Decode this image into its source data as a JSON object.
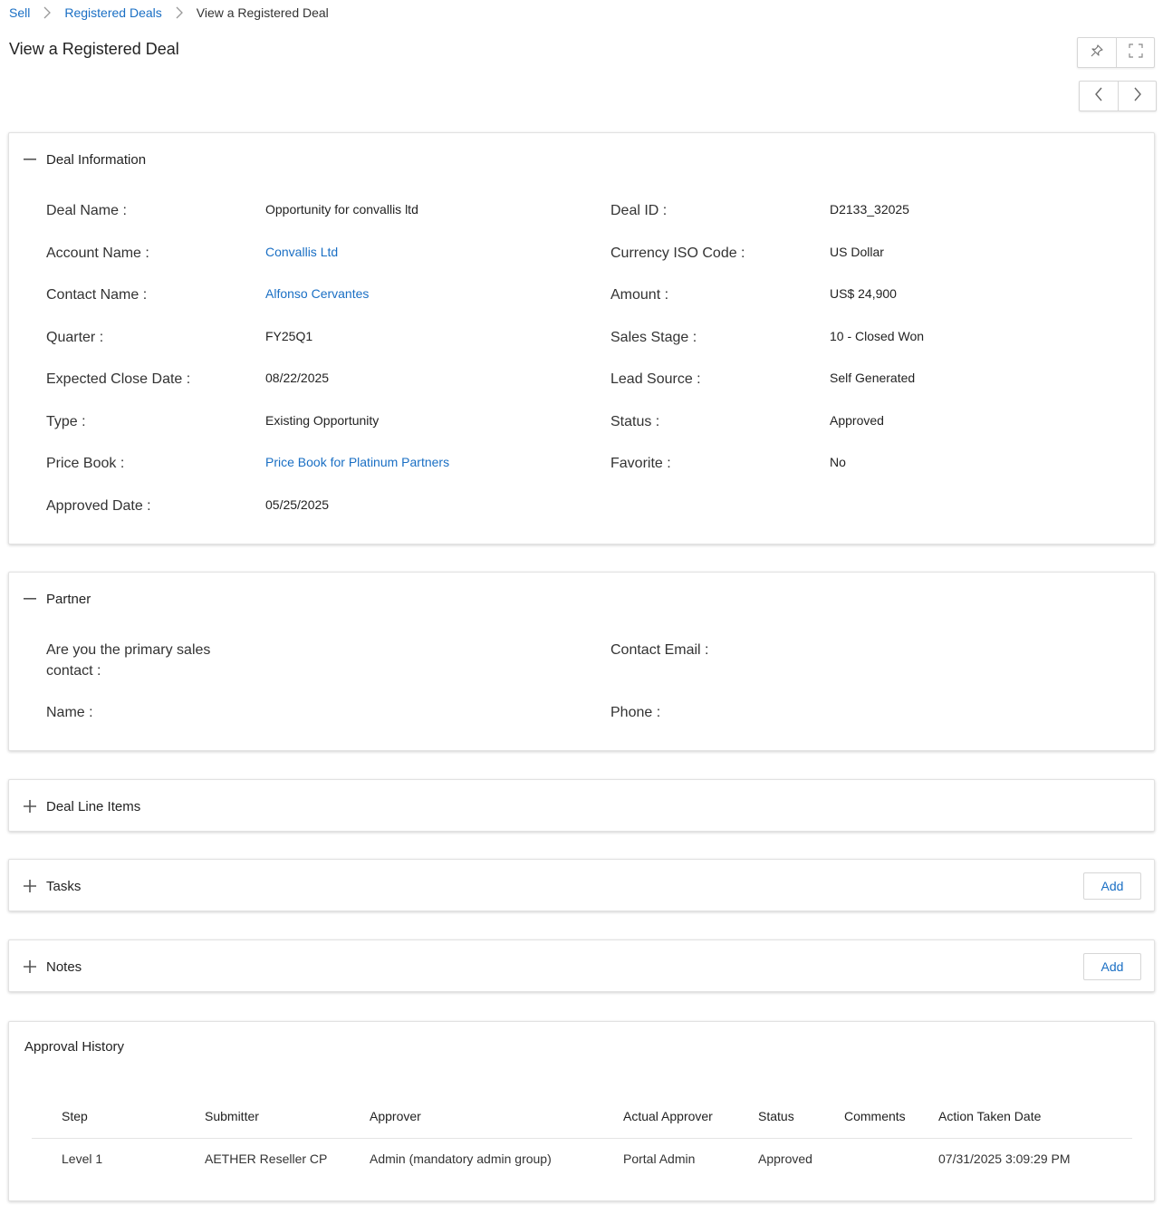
{
  "breadcrumb": {
    "items": [
      "Sell",
      "Registered Deals",
      "View a Registered Deal"
    ]
  },
  "page": {
    "title": "View a Registered Deal"
  },
  "deal_information": {
    "title": "Deal Information",
    "left_fields": [
      {
        "label": "Deal Name :",
        "value": "Opportunity for convallis ltd"
      },
      {
        "label": "Account Name :",
        "value": "Convallis Ltd"
      },
      {
        "label": "Contact Name :",
        "value": "Alfonso Cervantes"
      },
      {
        "label": "Quarter :",
        "value": "FY25Q1"
      },
      {
        "label": "Expected Close Date :",
        "value": "08/22/2025"
      },
      {
        "label": "Type :",
        "value": "Existing Opportunity"
      },
      {
        "label": "Price Book :",
        "value": "Price Book for Platinum Partners"
      },
      {
        "label": "Approved Date :",
        "value": "05/25/2025"
      }
    ],
    "right_fields": [
      {
        "label": "Deal ID :",
        "value": "D2133_32025"
      },
      {
        "label": "Currency ISO Code :",
        "value": "US Dollar"
      },
      {
        "label": "Amount :",
        "value": "US$ 24,900"
      },
      {
        "label": "Sales Stage :",
        "value": "10 - Closed Won"
      },
      {
        "label": "Lead Source :",
        "value": "Self Generated"
      },
      {
        "label": "Status :",
        "value": "Approved"
      },
      {
        "label": "Favorite :",
        "value": "No"
      }
    ]
  },
  "partner": {
    "title": "Partner",
    "primary_sales_contact_label": "Are you the primary sales contact :",
    "name_label": "Name :",
    "contact_email_label": "Contact Email :",
    "phone_label": "Phone :"
  },
  "deal_line_items": {
    "title": "Deal Line Items"
  },
  "tasks": {
    "title": "Tasks",
    "add_label": "Add"
  },
  "notes": {
    "title": "Notes",
    "add_label": "Add"
  },
  "approval_history": {
    "title": "Approval History",
    "columns": [
      "Step",
      "Submitter",
      "Approver",
      "Actual Approver",
      "Status",
      "Comments",
      "Action Taken Date"
    ],
    "rows": [
      [
        "Level 1",
        "AETHER Reseller CP",
        "Admin (mandatory admin group)",
        "Portal Admin",
        "Approved",
        "",
        "07/31/2025 3:09:29 PM"
      ]
    ]
  },
  "icons": {
    "pin": "pin-icon",
    "fullscreen": "fullscreen-icon",
    "prev": "chevron-left-icon",
    "next": "chevron-right-icon",
    "collapse": "minus-icon",
    "expand": "plus-icon",
    "separator": "chevron-right-icon"
  },
  "colors": {
    "link": "#1a6fc4",
    "border": "#d6d6d6"
  }
}
